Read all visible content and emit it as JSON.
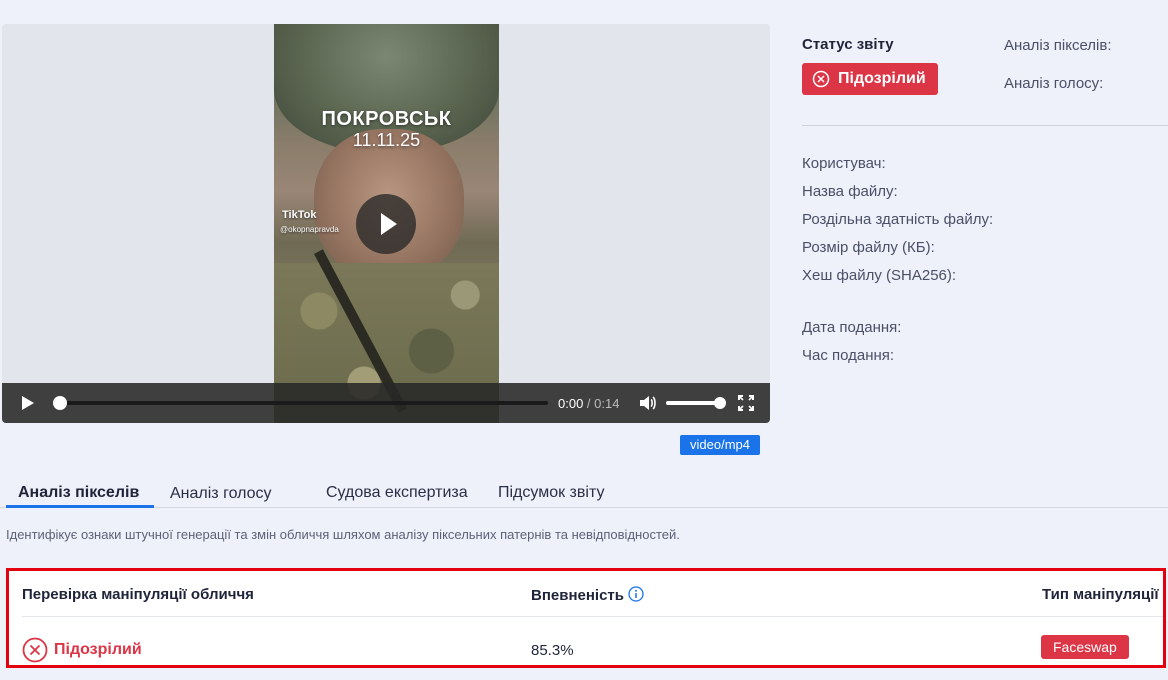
{
  "video": {
    "overlay_city": "ПОКРОВСЬК",
    "overlay_date": "11.11.25",
    "watermark_brand": "TikTok",
    "watermark_handle": "@okopnapravda",
    "current_time": "0:00",
    "separator": " / ",
    "duration": "0:14",
    "mime_type": "video/mp4"
  },
  "status": {
    "title": "Статус звіту",
    "badge": "Підозрілий",
    "pixel_analysis_label": "Аналіз пікселів:",
    "voice_analysis_label": "Аналіз голосу:"
  },
  "details": {
    "user_label": "Користувач:",
    "filename_label": "Назва файлу:",
    "resolution_label": "Роздільна здатність файлу:",
    "filesize_label": "Розмір файлу (КБ):",
    "hash_label": "Хеш файлу (SHA256):",
    "submit_date_label": "Дата подання:",
    "submit_time_label": "Час подання:"
  },
  "tabs": [
    {
      "label": "Аналіз пікселів"
    },
    {
      "label": "Аналіз голосу"
    },
    {
      "label": "Судова експертиза"
    },
    {
      "label": "Підсумок звіту"
    }
  ],
  "description": "Ідентифікує ознаки штучної генерації та змін обличчя шляхом аналізу піксельних патернів та невідповідностей.",
  "results": {
    "col_check": "Перевірка маніпуляції обличчя",
    "col_confidence": "Впевненість",
    "col_type": "Тип маніпуляції",
    "status": "Підозрілий",
    "confidence": "85.3%",
    "type": "Faceswap"
  },
  "colors": {
    "danger": "#dc3545",
    "accent": "#1a73e8",
    "highlight_border": "#e3000f",
    "background": "#eef0fa"
  },
  "icons": {
    "status": "x-circle-icon",
    "info": "info-circle-icon",
    "play": "play-icon",
    "volume": "volume-icon",
    "fullscreen": "fullscreen-icon"
  }
}
